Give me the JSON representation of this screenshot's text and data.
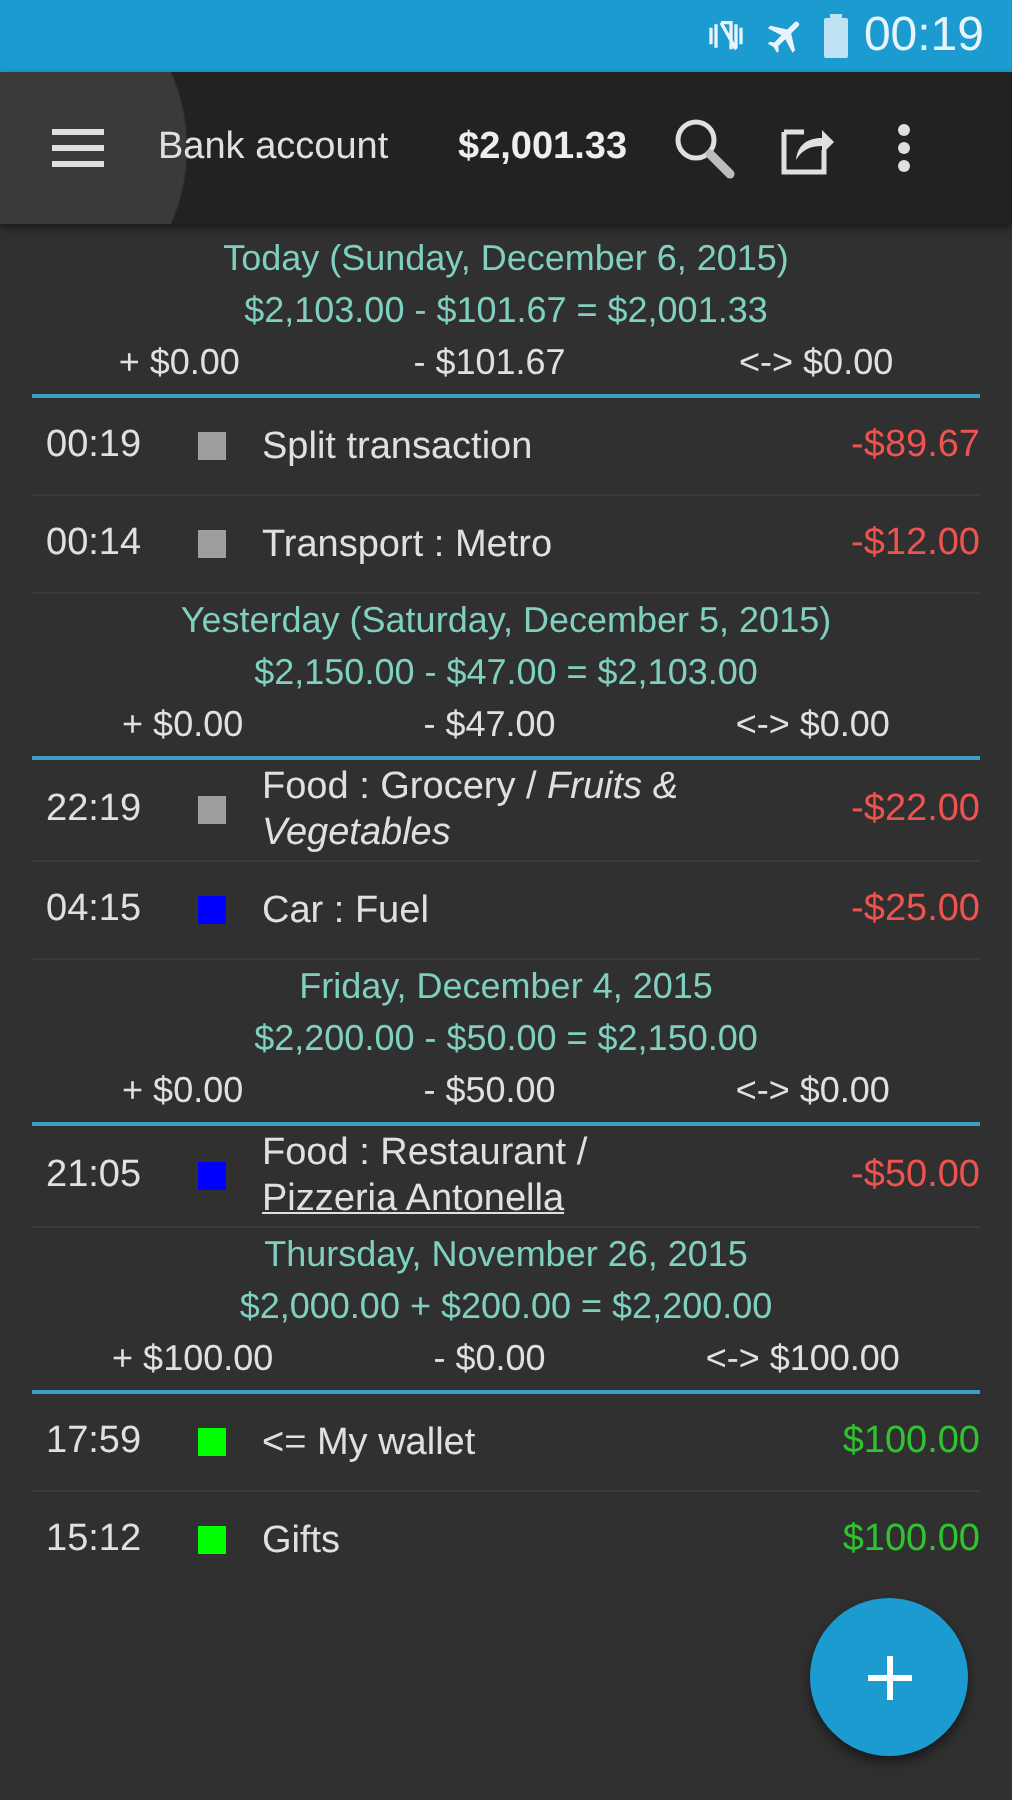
{
  "status_bar": {
    "time": "00:19"
  },
  "toolbar": {
    "menu_pressed": true,
    "account": "Bank account",
    "balance": "$2,001.33"
  },
  "days": [
    {
      "title": "Today (Sunday, December 6, 2015)",
      "formula": "$2,103.00 - $101.67 = $2,001.33",
      "income": "+ $0.00",
      "expense": "- $101.67",
      "transfer": "<-> $0.00",
      "transactions": [
        {
          "time": "00:19",
          "color": "#9e9e9e",
          "description": "Split transaction",
          "amount": "-$89.67",
          "kind": "expense"
        },
        {
          "time": "00:14",
          "color": "#9e9e9e",
          "description": "Transport : Metro",
          "amount": "-$12.00",
          "kind": "expense"
        }
      ]
    },
    {
      "title": "Yesterday (Saturday, December 5, 2015)",
      "formula": "$2,150.00 - $47.00 = $2,103.00",
      "income": "+ $0.00",
      "expense": "- $47.00",
      "transfer": "<-> $0.00",
      "transactions": [
        {
          "time": "22:19",
          "color": "#9e9e9e",
          "description": "Food : Grocery / *Fruits & Vegetables*",
          "amount": "-$22.00",
          "kind": "expense"
        },
        {
          "time": "04:15",
          "color": "#0000ff",
          "description": "Car : Fuel",
          "amount": "-$25.00",
          "kind": "expense"
        }
      ]
    },
    {
      "title": "Friday, December 4, 2015",
      "formula": "$2,200.00 - $50.00 = $2,150.00",
      "income": "+ $0.00",
      "expense": "- $50.00",
      "transfer": "<-> $0.00",
      "transactions": [
        {
          "time": "21:05",
          "color": "#0000ff",
          "description": "Food : Restaurant / ",
          "link": "Pizzeria Antonella",
          "amount": "-$50.00",
          "kind": "expense"
        }
      ]
    },
    {
      "title": "Thursday, November 26, 2015",
      "formula": "$2,000.00 + $200.00 = $2,200.00",
      "income": "+ $100.00",
      "expense": "- $0.00",
      "transfer": "<-> $100.00",
      "transactions": [
        {
          "time": "17:59",
          "color": "#00ff00",
          "description": "<= My wallet",
          "amount": "$100.00",
          "kind": "income"
        },
        {
          "time": "15:12",
          "color": "#00ff00",
          "description": "Gifts",
          "amount": "$100.00",
          "kind": "income"
        }
      ]
    }
  ]
}
